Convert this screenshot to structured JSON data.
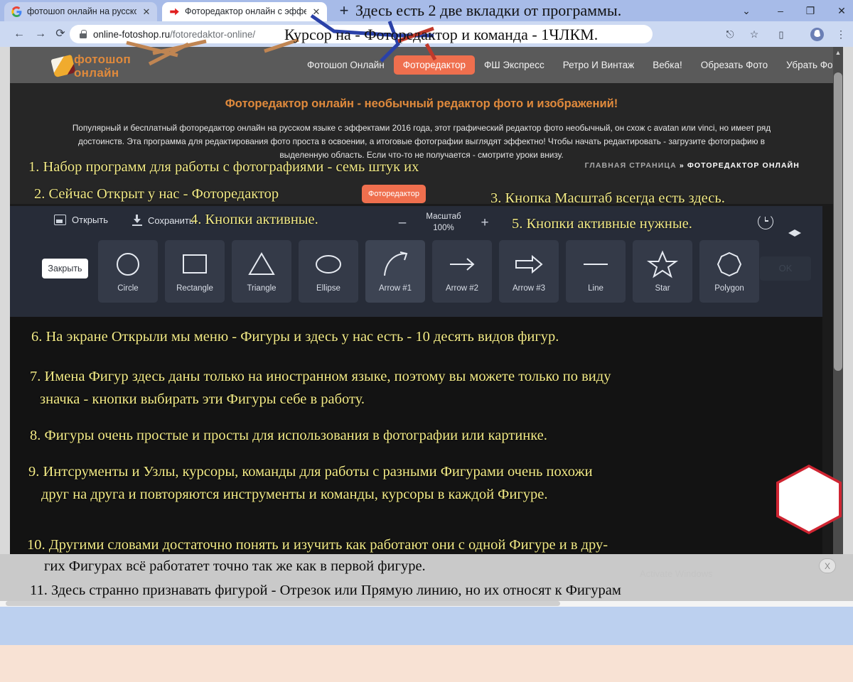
{
  "browser": {
    "tabs": [
      {
        "title": "фотошоп онлайн на русском - ",
        "favicon": "google-icon",
        "active": false
      },
      {
        "title": "Фоторедактор онлайн с эффект",
        "favicon": "red-arrow-icon",
        "active": true
      }
    ],
    "new_tab_label": "+",
    "window_controls": {
      "minimize": "–",
      "maximize": "❐",
      "close": "✕",
      "chevron": "⌄"
    },
    "nav": {
      "back": "←",
      "forward": "→",
      "reload": "⟳"
    },
    "omnibox": {
      "url_main": "online-fotoshop.ru",
      "url_path": "/fotoredaktor-online/",
      "lock_icon": "lock-icon"
    },
    "toolbar_icons": [
      "share-icon",
      "star-icon",
      "sidepanel-icon",
      "profile-avatar",
      "kebab-menu-icon"
    ]
  },
  "site": {
    "logo": {
      "line1": "фотошоп",
      "line2": "онлайн",
      "icon": "paintbrush-icon"
    },
    "nav_items": [
      {
        "label": "Фотошоп Онлайн",
        "active": false
      },
      {
        "label": "Фоторедактор",
        "active": true
      },
      {
        "label": "ФШ Экспресс",
        "active": false
      },
      {
        "label": "Ретро И Винтаж",
        "active": false
      },
      {
        "label": "Вебка!",
        "active": false
      },
      {
        "label": "Обрезать Фото",
        "active": false
      },
      {
        "label": "Убрать Фон",
        "active": false
      }
    ],
    "hero": {
      "title": "Фоторедактор онлайн - необычный редактор фото и изображений!",
      "body": "Популярный и бесплатный фоторедактор онлайн на русском языке с эффектами 2016 года, этот графический редактор фото необычный, он схож с avatan или vinci, но имеет ряд достоинств. Эта программа для редактирования фото проста в освоении, а итоговые фотографии выглядят эффектно! Чтобы начать редактировать - загрузите фотографию в выделенную область. Если что-то не получается - смотрите уроки внизу."
    },
    "breadcrumb": {
      "home": "ГЛАВНАЯ СТРАНИЦА",
      "sep": "»",
      "current": "ФОТОРЕДАКТОР ОНЛАЙН"
    }
  },
  "editor": {
    "open_label": "Открыть",
    "save_label": "Сохранить",
    "zoom": {
      "title": "Масштаб",
      "value": "100%",
      "minus": "–",
      "plus": "+"
    },
    "right_icons": [
      "history-icon",
      "layers-icon"
    ],
    "close_label": "Закрыть",
    "ok_label": "OK",
    "shapes": [
      {
        "label": "Circle",
        "icon": "circle-icon",
        "selected": false
      },
      {
        "label": "Rectangle",
        "icon": "rectangle-icon",
        "selected": false
      },
      {
        "label": "Triangle",
        "icon": "triangle-icon",
        "selected": false
      },
      {
        "label": "Ellipse",
        "icon": "ellipse-icon",
        "selected": false
      },
      {
        "label": "Arrow #1",
        "icon": "curved-arrow-icon",
        "selected": true
      },
      {
        "label": "Arrow #2",
        "icon": "straight-arrow-icon",
        "selected": false
      },
      {
        "label": "Arrow #3",
        "icon": "block-arrow-icon",
        "selected": false
      },
      {
        "label": "Line",
        "icon": "line-icon",
        "selected": false
      },
      {
        "label": "Star",
        "icon": "star-icon",
        "selected": false
      },
      {
        "label": "Polygon",
        "icon": "polygon-icon",
        "selected": false
      }
    ]
  },
  "annotations": {
    "top1": "Здесь есть 2 две вкладки от программы.",
    "top2": "Курсор на - Фоторедактор и команда - 1ЧЛКМ.",
    "n1": "1. Набор программ для работы с фотографиями - семь штук их",
    "n2": "2. Сейчас Открыт у нас - Фоторедактор",
    "n2_badge": "Фоторедактор",
    "n3": "3. Кнопка Масштаб всегда есть здесь.",
    "n4": "4. Кнопки активные.",
    "n5": "5. Кнопки активные нужные.",
    "n6": "6. На экране Открыли мы меню - Фигуры и здесь у нас есть - 10 десять видов фигур.",
    "n7a": "7. Имена Фигур здесь даны только на иностранном языке, поэтому вы можете только по виду",
    "n7b": "значка - кнопки выбирать эти Фигуры себе в работу.",
    "n8": "8. Фигуры очень простые и просты для использования в фотографии или картинке.",
    "n9a": "9. Интсрументы и Узлы, курсоры, команды для работы с разными Фигурами очень похожи",
    "n9b": "друг на друга и повторяются инструменты и команды, курсоры в каждой Фигуре.",
    "n10a": "10. Другими словами достаточно понять и изучить как работают они с одной Фигуре и в дру-",
    "n10b": "гих Фигурах всё работатет точно так же как в первой фигуре.",
    "n11": "11. Здесь странно признавать фигурой - Отрезок или Прямую линию, но их относят к Фигурам",
    "close_x": "X",
    "watermark": "Activate Windows"
  },
  "colors": {
    "accent_orange": "#ef6f4e",
    "hero_title": "#e08a3c",
    "annotation_yellow": "#f2ea86",
    "editor_bg": "#272c38",
    "shape_tile": "#343a48",
    "hexagon_stroke": "#cf2532"
  }
}
